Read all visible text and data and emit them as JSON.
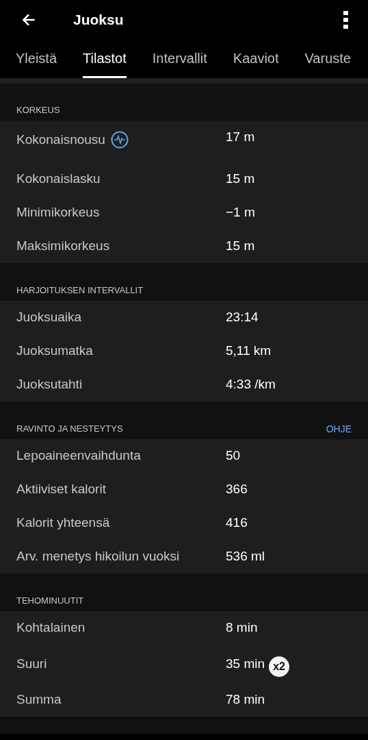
{
  "app_bar": {
    "title": "Juoksu"
  },
  "tabs": [
    {
      "label": "Yleistä",
      "selected": false
    },
    {
      "label": "Tilastot",
      "selected": true
    },
    {
      "label": "Intervallit",
      "selected": false
    },
    {
      "label": "Kaaviot",
      "selected": false
    },
    {
      "label": "Varuste",
      "selected": false
    }
  ],
  "sections": [
    {
      "title": "KORKEUS",
      "rows": [
        {
          "label": "Kokonaisnousu",
          "value": "17 m",
          "info_icon": true
        },
        {
          "label": "Kokonaislasku",
          "value": "15 m"
        },
        {
          "label": "Minimikorkeus",
          "value": "−1 m"
        },
        {
          "label": "Maksimikorkeus",
          "value": "15 m"
        }
      ]
    },
    {
      "title": "HARJOITUKSEN INTERVALLIT",
      "rows": [
        {
          "label": "Juoksuaika",
          "value": "23:14"
        },
        {
          "label": "Juoksumatka",
          "value": "5,11 km"
        },
        {
          "label": "Juoksutahti",
          "value": "4:33 /km"
        }
      ]
    },
    {
      "title": "RAVINTO JA NESTEYTYS",
      "link": "OHJE",
      "rows": [
        {
          "label": "Lepoaineenvaihdunta",
          "value": "50"
        },
        {
          "label": "Aktiiviset kalorit",
          "value": "366"
        },
        {
          "label": "Kalorit yhteensä",
          "value": "416"
        },
        {
          "label": "Arv. menetys hikoilun vuoksi",
          "value": "536 ml"
        }
      ]
    },
    {
      "title": "TEHOMINUUTIT",
      "rows": [
        {
          "label": "Kohtalainen",
          "value": "8 min"
        },
        {
          "label": "Suuri",
          "value": "35 min",
          "badge": "x2"
        },
        {
          "label": "Summa",
          "value": "78 min"
        }
      ]
    }
  ]
}
